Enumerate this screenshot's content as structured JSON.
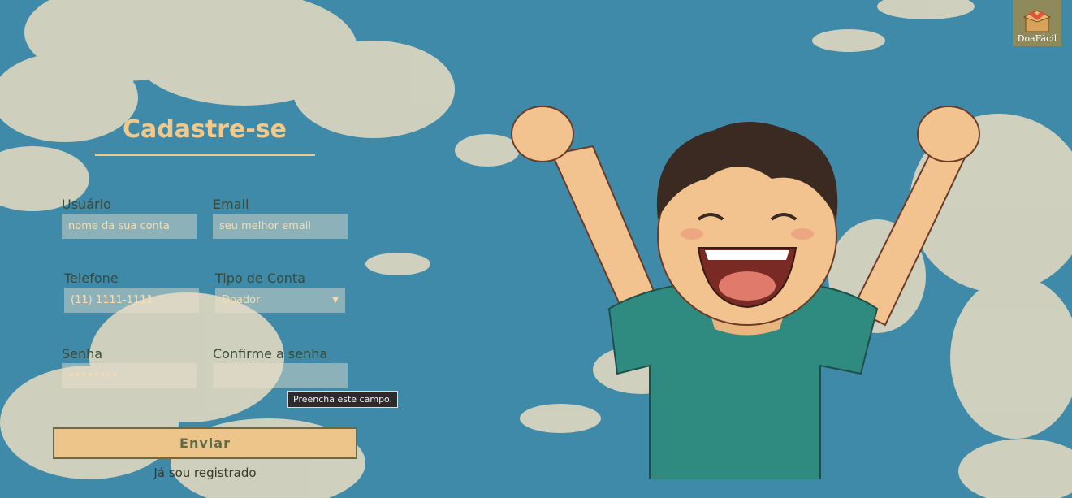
{
  "brand": {
    "logo_text": "DoaFácil"
  },
  "form": {
    "title": "Cadastre-se",
    "fields": {
      "username": {
        "label": "Usuário",
        "placeholder": "nome da sua conta"
      },
      "email": {
        "label": "Email",
        "placeholder": "seu melhor email"
      },
      "phone": {
        "label": "Telefone",
        "value": "(11) 1111-1111"
      },
      "account_type": {
        "label": "Tipo de Conta",
        "selected": "Doador"
      },
      "password": {
        "label": "Senha",
        "value": "••••••••"
      },
      "confirm_password": {
        "label": "Confirme a senha",
        "value": ""
      }
    },
    "validation_tooltip": "Preencha este campo.",
    "submit_label": "Enviar",
    "login_link": "Já sou registrado"
  },
  "colors": {
    "accent": "#f2c98b",
    "button": "#edc58a",
    "sky": "#3f8aa8",
    "shirt": "#2f8a80"
  },
  "icons": [
    "gift-box-heart-icon",
    "chevron-down-icon"
  ]
}
